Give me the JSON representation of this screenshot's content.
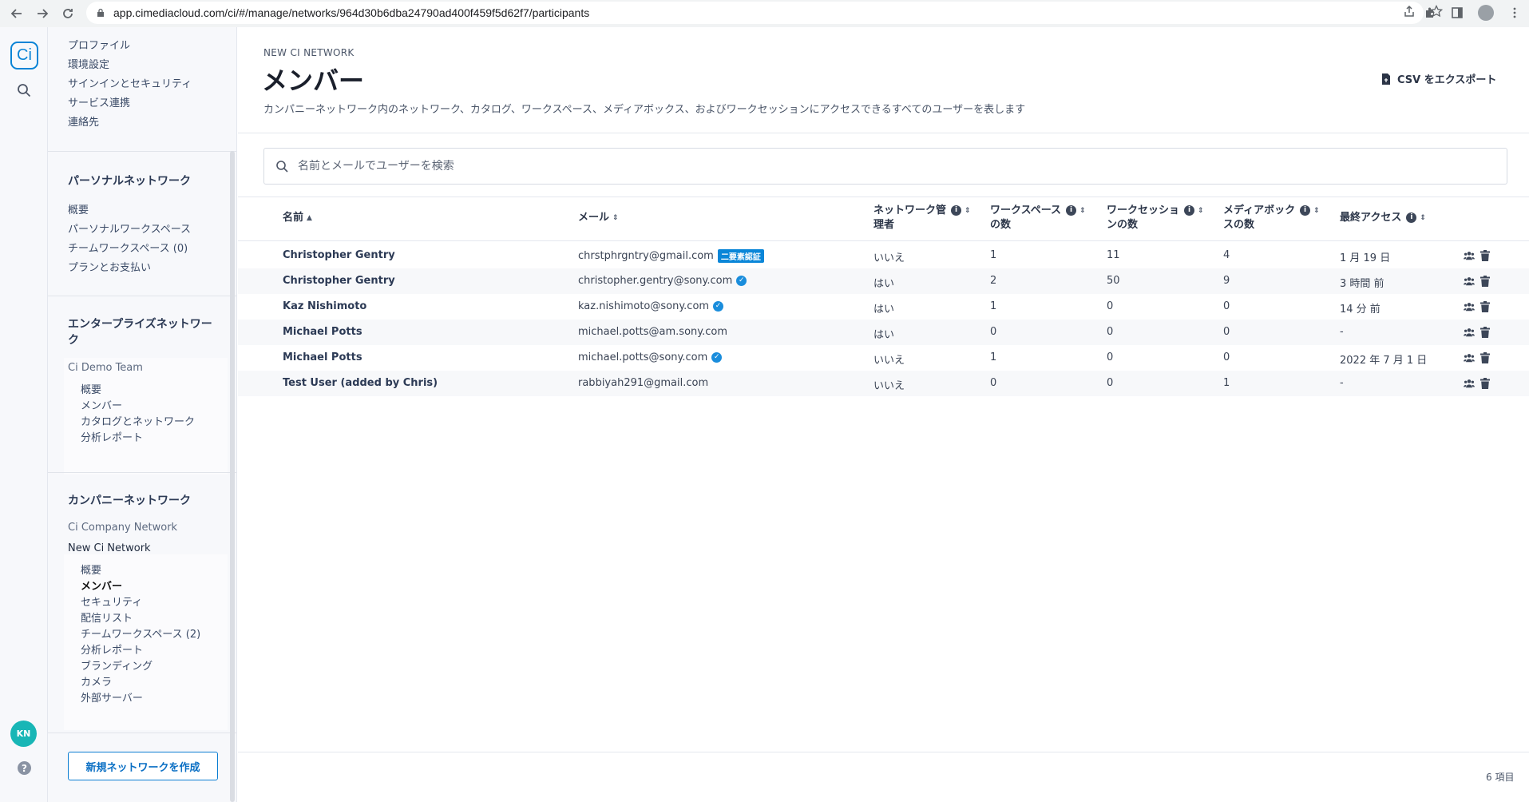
{
  "browser": {
    "url": "app.cimediacloud.com/ci/#/manage/networks/964d30b6dba24790ad400f459f5d62f7/participants"
  },
  "rail": {
    "logo": "Ci",
    "avatar": "KN",
    "help": "?"
  },
  "sidebar": {
    "account_links": [
      "プロファイル",
      "環境設定",
      "サインインとセキュリティ",
      "サービス連携",
      "連絡先"
    ],
    "personal": {
      "heading": "パーソナルネットワーク",
      "items": [
        "概要",
        "パーソナルワークスペース",
        "チームワークスペース (0)",
        "プランとお支払い"
      ]
    },
    "enterprise": {
      "heading": "エンタープライズネットワーク",
      "team": "Ci Demo Team",
      "items": [
        "概要",
        "メンバー",
        "カタログとネットワーク",
        "分析レポート"
      ]
    },
    "company": {
      "heading": "カンパニーネットワーク",
      "network1": "Ci Company Network",
      "network2": "New Ci Network",
      "items": [
        "概要",
        "メンバー",
        "セキュリティ",
        "配信リスト",
        "チームワークスペース (2)",
        "分析レポート",
        "ブランディング",
        "カメラ",
        "外部サーバー"
      ],
      "active_item": "メンバー"
    },
    "new_network_button": "新規ネットワークを作成"
  },
  "main": {
    "eyebrow": "NEW CI NETWORK",
    "title": "メンバー",
    "description": "カンパニーネットワーク内のネットワーク、カタログ、ワークスペース、メディアボックス、およびワークセッションにアクセスできるすべてのユーザーを表します",
    "csv_export": "CSV をエクスポート",
    "search_placeholder": "名前とメールでユーザーを検索",
    "columns": {
      "name": "名前",
      "email": "メール",
      "admin_l1": "ネットワーク管",
      "admin_l2": "理者",
      "workspaces_l1": "ワークスペース",
      "workspaces_l2": "の数",
      "worksessions_l1": "ワークセッショ",
      "worksessions_l2": "ンの数",
      "mediaboxes_l1": "メディアボック",
      "mediaboxes_l2": "スの数",
      "last_access": "最終アクセス"
    },
    "rows": [
      {
        "name": "Christopher Gentry",
        "email": "chrstphrgntry@gmail.com",
        "badge": "二要素認証",
        "verified": false,
        "admin": "いいえ",
        "workspaces": "1",
        "worksessions": "11",
        "mediaboxes": "4",
        "last_access": "1 月 19 日"
      },
      {
        "name": "Christopher Gentry",
        "email": "christopher.gentry@sony.com",
        "badge": "",
        "verified": true,
        "admin": "はい",
        "workspaces": "2",
        "worksessions": "50",
        "mediaboxes": "9",
        "last_access": "3 時間 前"
      },
      {
        "name": "Kaz Nishimoto",
        "email": "kaz.nishimoto@sony.com",
        "badge": "",
        "verified": true,
        "admin": "はい",
        "workspaces": "1",
        "worksessions": "0",
        "mediaboxes": "0",
        "last_access": "14 分 前"
      },
      {
        "name": "Michael Potts",
        "email": "michael.potts@am.sony.com",
        "badge": "",
        "verified": false,
        "admin": "はい",
        "workspaces": "0",
        "worksessions": "0",
        "mediaboxes": "0",
        "last_access": "-"
      },
      {
        "name": "Michael Potts",
        "email": "michael.potts@sony.com",
        "badge": "",
        "verified": true,
        "admin": "いいえ",
        "workspaces": "1",
        "worksessions": "0",
        "mediaboxes": "0",
        "last_access": "2022 年 7 月 1 日"
      },
      {
        "name": "Test User (added by Chris)",
        "email": "rabbiyah291@gmail.com",
        "badge": "",
        "verified": false,
        "admin": "いいえ",
        "workspaces": "0",
        "worksessions": "0",
        "mediaboxes": "1",
        "last_access": "-"
      }
    ],
    "item_count": "6 項目"
  },
  "colors": {
    "accent": "#0a84d6",
    "avatar_bg": "#18b6b6"
  }
}
